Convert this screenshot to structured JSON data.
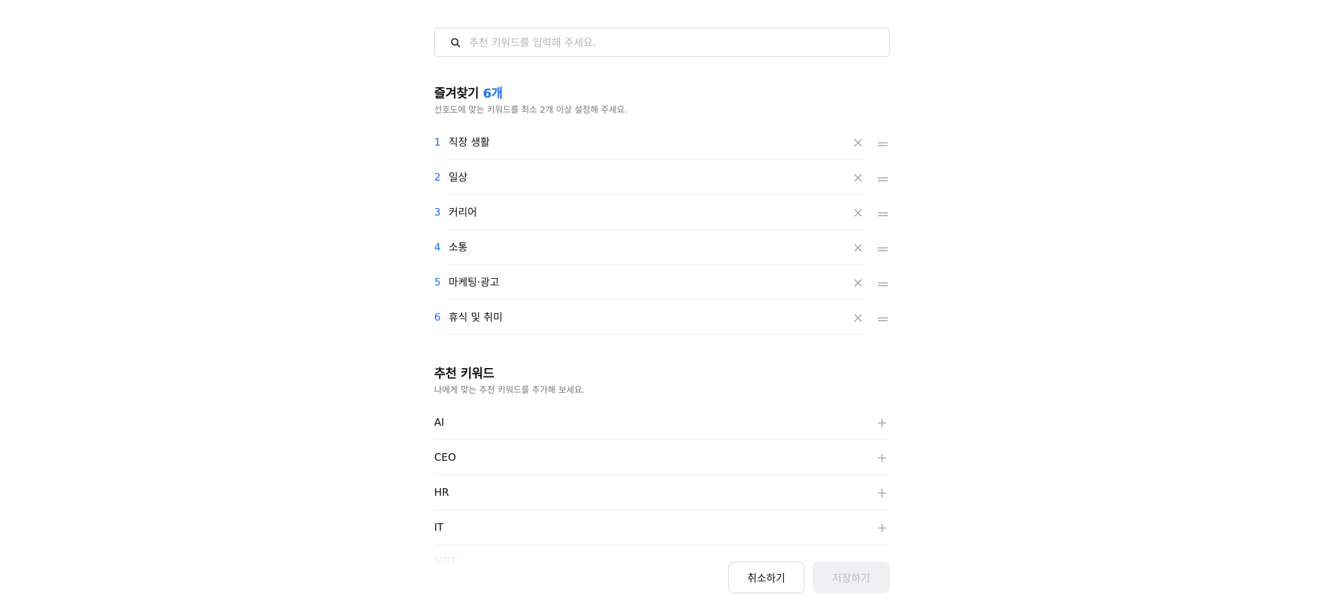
{
  "search": {
    "placeholder": "추천 키워드를 입력해 주세요.",
    "icon": "search-icon"
  },
  "favorites": {
    "title": "즐겨찾기",
    "count_label": "6개",
    "description": "선호도에 맞는 키워드를 최소 2개 이상 설정해 주세요.",
    "items": [
      {
        "index": "1",
        "label": "직장 생활"
      },
      {
        "index": "2",
        "label": "일상"
      },
      {
        "index": "3",
        "label": "커리어"
      },
      {
        "index": "4",
        "label": "소통"
      },
      {
        "index": "5",
        "label": "마케팅·광고"
      },
      {
        "index": "6",
        "label": "휴식 및 취미"
      }
    ]
  },
  "recommended": {
    "title": "추천 키워드",
    "description": "나에게 맞는 추천 키워드를 추가해 보세요.",
    "items": [
      {
        "label": "AI"
      },
      {
        "label": "CEO"
      },
      {
        "label": "HR"
      },
      {
        "label": "IT"
      }
    ],
    "faded_item": "MBTI"
  },
  "footer": {
    "cancel_label": "취소하기",
    "save_label": "저장하기"
  },
  "colors": {
    "accent": "#1f6feb",
    "border": "#d9d9de",
    "divider": "#ececef",
    "muted_text": "#777780",
    "disabled_bg": "#f0f0f2",
    "disabled_text": "#b9b9c0"
  }
}
